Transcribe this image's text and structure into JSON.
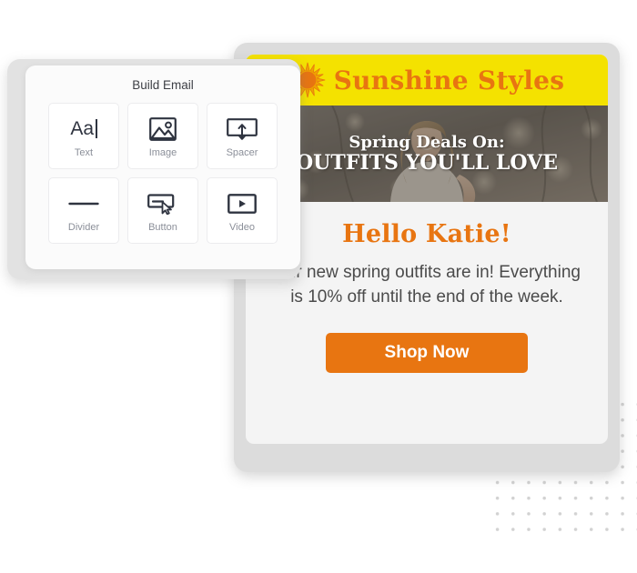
{
  "builder": {
    "title": "Build Email",
    "widgets": [
      {
        "label": "Text",
        "icon": "text-aa-icon"
      },
      {
        "label": "Image",
        "icon": "image-icon"
      },
      {
        "label": "Spacer",
        "icon": "spacer-icon"
      },
      {
        "label": "Divider",
        "icon": "divider-icon"
      },
      {
        "label": "Button",
        "icon": "button-cursor-icon"
      },
      {
        "label": "Video",
        "icon": "video-play-icon"
      }
    ]
  },
  "email": {
    "brand": {
      "name": "Sunshine Styles",
      "icon": "sun-icon",
      "banner_color": "#F4E200",
      "text_color": "#E87511"
    },
    "hero": {
      "line1": "Spring Deals On:",
      "line2": "OUTFITS YOU'LL LOVE"
    },
    "greeting": "Hello Katie!",
    "body": "Our new spring outfits are in! Everything is 10% off until the end of the week.",
    "cta_label": "Shop Now",
    "cta_color": "#E87511"
  },
  "decoration": {
    "dot_grid_color": "#D2D2D2"
  }
}
